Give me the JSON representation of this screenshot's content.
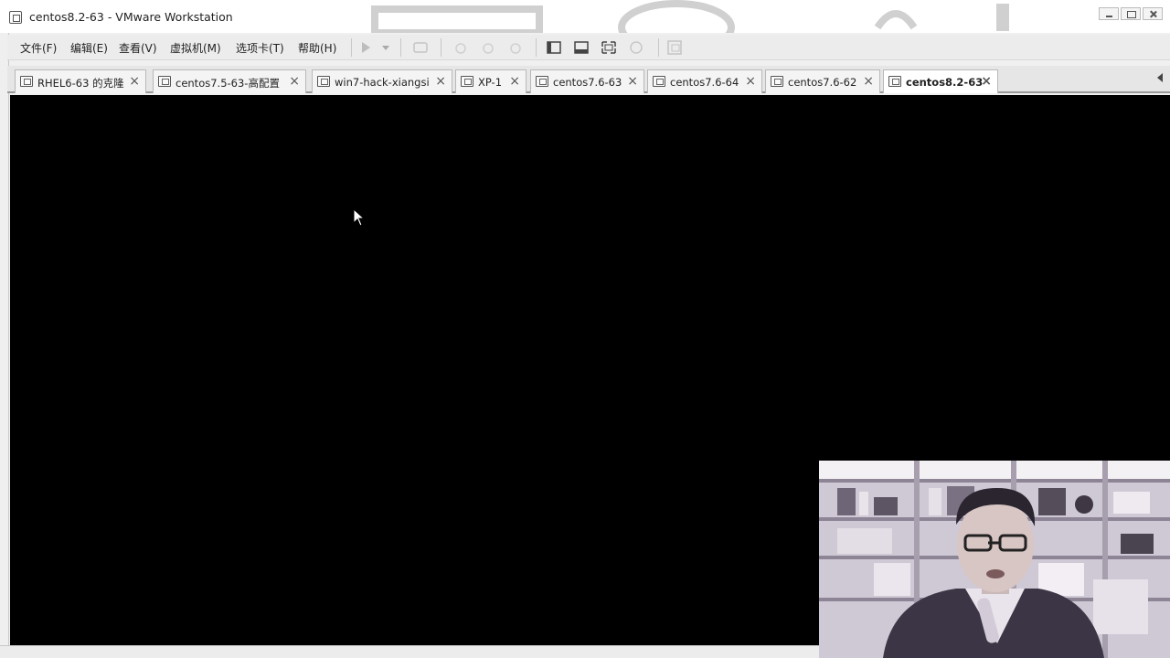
{
  "window": {
    "title": "centos8.2-63 - VMware Workstation"
  },
  "menu": {
    "file": "文件(F)",
    "edit": "编辑(E)",
    "view": "查看(V)",
    "vm": "虚拟机(M)",
    "tabs": "选项卡(T)",
    "help": "帮助(H)"
  },
  "toolbar_icons": [
    "play-icon",
    "dropdown-arrow-icon",
    "send-keys-icon",
    "snapshot-icon",
    "revert-snapshot-icon",
    "manage-snapshots-icon",
    "console-view-icon",
    "unity-view-icon",
    "fullscreen-icon",
    "thumbnail-icon",
    "library-icon"
  ],
  "tabs": [
    {
      "label": "RHEL6-63 的克隆",
      "active": false
    },
    {
      "label": "centos7.5-63-高配置",
      "active": false
    },
    {
      "label": "win7-hack-xiangsi",
      "active": false
    },
    {
      "label": "XP-1",
      "active": false
    },
    {
      "label": "centos7.6-63",
      "active": false
    },
    {
      "label": "centos7.6-64",
      "active": false
    },
    {
      "label": "centos7.6-62",
      "active": false
    },
    {
      "label": "centos8.2-63",
      "active": true
    }
  ],
  "tab_close_glyph": "×",
  "colors": {
    "console_bg": "#000000",
    "chrome_bg": "#ececec"
  }
}
